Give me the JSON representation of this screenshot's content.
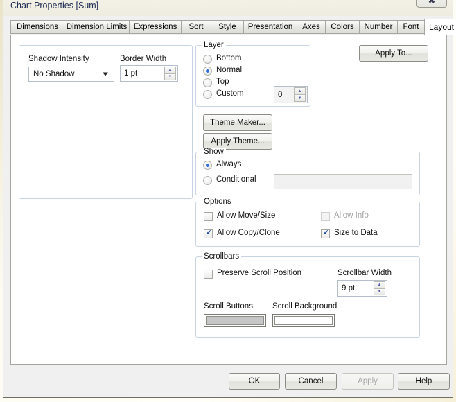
{
  "window": {
    "title": "Chart Properties [Sum]",
    "close_icon": "close-icon",
    "close_glyph": "✖"
  },
  "tabs": {
    "items": [
      {
        "label": "Dimensions",
        "active": false
      },
      {
        "label": "Dimension Limits",
        "active": false
      },
      {
        "label": "Expressions",
        "active": false
      },
      {
        "label": "Sort",
        "active": false
      },
      {
        "label": "Style",
        "active": false
      },
      {
        "label": "Presentation",
        "active": false
      },
      {
        "label": "Axes",
        "active": false
      },
      {
        "label": "Colors",
        "active": false
      },
      {
        "label": "Number",
        "active": false
      },
      {
        "label": "Font",
        "active": false
      },
      {
        "label": "Layout",
        "active": true
      }
    ],
    "nav_prev": "◄",
    "nav_next": "►"
  },
  "appearance": {
    "shadow_intensity_label": "Shadow Intensity",
    "shadow_intensity_value": "No Shadow",
    "border_width_label": "Border Width",
    "border_width_value": "1 pt"
  },
  "apply_to": {
    "label": "Apply To..."
  },
  "layer": {
    "legend": "Layer",
    "options": [
      {
        "label": "Bottom",
        "selected": false
      },
      {
        "label": "Normal",
        "selected": true
      },
      {
        "label": "Top",
        "selected": false
      },
      {
        "label": "Custom",
        "selected": false
      }
    ],
    "custom_value": "0"
  },
  "theme": {
    "maker_label": "Theme Maker...",
    "apply_label": "Apply Theme..."
  },
  "show": {
    "legend": "Show",
    "options": [
      {
        "label": "Always",
        "selected": true
      },
      {
        "label": "Conditional",
        "selected": false
      }
    ],
    "conditional_value": ""
  },
  "options": {
    "legend": "Options",
    "items": [
      {
        "label": "Allow Move/Size",
        "checked": false,
        "enabled": true
      },
      {
        "label": "Allow Info",
        "checked": false,
        "enabled": false
      },
      {
        "label": "Allow Copy/Clone",
        "checked": true,
        "enabled": true
      },
      {
        "label": "Size to Data",
        "checked": true,
        "enabled": true
      }
    ]
  },
  "scrollbars": {
    "legend": "Scrollbars",
    "preserve_label": "Preserve Scroll Position",
    "preserve_checked": false,
    "width_label": "Scrollbar Width",
    "width_value": "9 pt",
    "scroll_buttons_label": "Scroll Buttons",
    "scroll_buttons_color": "#c6c6c6",
    "scroll_background_label": "Scroll Background",
    "scroll_background_color": "#ffffff"
  },
  "footer": {
    "ok": "OK",
    "cancel": "Cancel",
    "apply": "Apply",
    "help": "Help"
  }
}
